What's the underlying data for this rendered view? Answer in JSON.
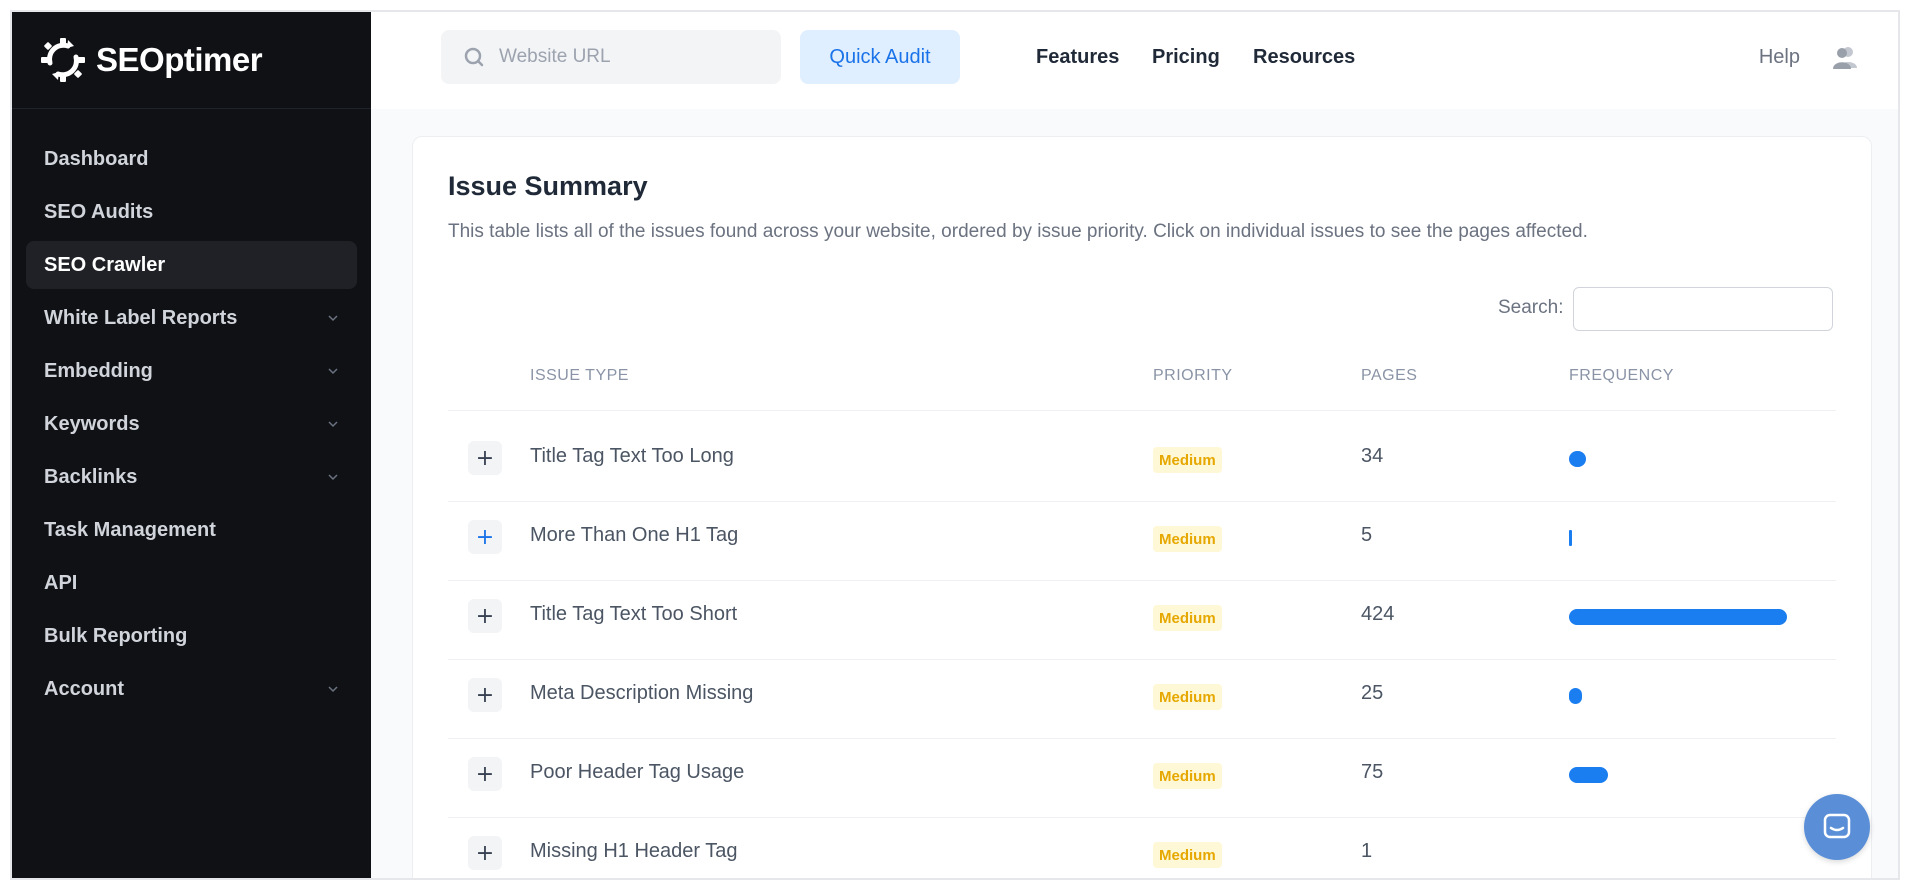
{
  "brand": {
    "name": "SEOptimer"
  },
  "sidebar": {
    "items": [
      {
        "label": "Dashboard",
        "active": false,
        "has_submenu": false
      },
      {
        "label": "SEO Audits",
        "active": false,
        "has_submenu": false
      },
      {
        "label": "SEO Crawler",
        "active": true,
        "has_submenu": false
      },
      {
        "label": "White Label Reports",
        "active": false,
        "has_submenu": true
      },
      {
        "label": "Embedding",
        "active": false,
        "has_submenu": true
      },
      {
        "label": "Keywords",
        "active": false,
        "has_submenu": true
      },
      {
        "label": "Backlinks",
        "active": false,
        "has_submenu": true
      },
      {
        "label": "Task Management",
        "active": false,
        "has_submenu": false
      },
      {
        "label": "API",
        "active": false,
        "has_submenu": false
      },
      {
        "label": "Bulk Reporting",
        "active": false,
        "has_submenu": false
      },
      {
        "label": "Account",
        "active": false,
        "has_submenu": true
      }
    ]
  },
  "topbar": {
    "url_placeholder": "Website URL",
    "quick_audit_label": "Quick Audit",
    "links": [
      "Features",
      "Pricing",
      "Resources"
    ],
    "help_label": "Help"
  },
  "main": {
    "title": "Issue Summary",
    "description": "This table lists all of the issues found across your website, ordered by issue priority. Click on individual issues to see the pages affected.",
    "search_label": "Search:",
    "columns": [
      "ISSUE TYPE",
      "PRIORITY",
      "PAGES",
      "FREQUENCY"
    ],
    "rows": [
      {
        "issue": "Title Tag Text Too Long",
        "priority": "Medium",
        "pages": "34",
        "frequency_fraction": 0.08,
        "expand_highlight": false
      },
      {
        "issue": "More Than One H1 Tag",
        "priority": "Medium",
        "pages": "5",
        "frequency_fraction": 0.012,
        "expand_highlight": true
      },
      {
        "issue": "Title Tag Text Too Short",
        "priority": "Medium",
        "pages": "424",
        "frequency_fraction": 1.0,
        "expand_highlight": false
      },
      {
        "issue": "Meta Description Missing",
        "priority": "Medium",
        "pages": "25",
        "frequency_fraction": 0.059,
        "expand_highlight": false
      },
      {
        "issue": "Poor Header Tag Usage",
        "priority": "Medium",
        "pages": "75",
        "frequency_fraction": 0.177,
        "expand_highlight": false
      },
      {
        "issue": "Missing H1 Header Tag",
        "priority": "Medium",
        "pages": "1",
        "frequency_fraction": 0.0,
        "expand_highlight": false
      }
    ]
  },
  "colors": {
    "sidebar_bg": "#0f1115",
    "accent": "#1a7ef0",
    "badge_bg": "#fff8d6",
    "badge_text": "#e6a800"
  },
  "icons": {
    "logo": "seoptimer-gear-icon",
    "search": "search-icon",
    "user": "users-icon",
    "chat": "chat-icon",
    "chevron": "chevron-down-icon",
    "expand": "plus-icon"
  }
}
